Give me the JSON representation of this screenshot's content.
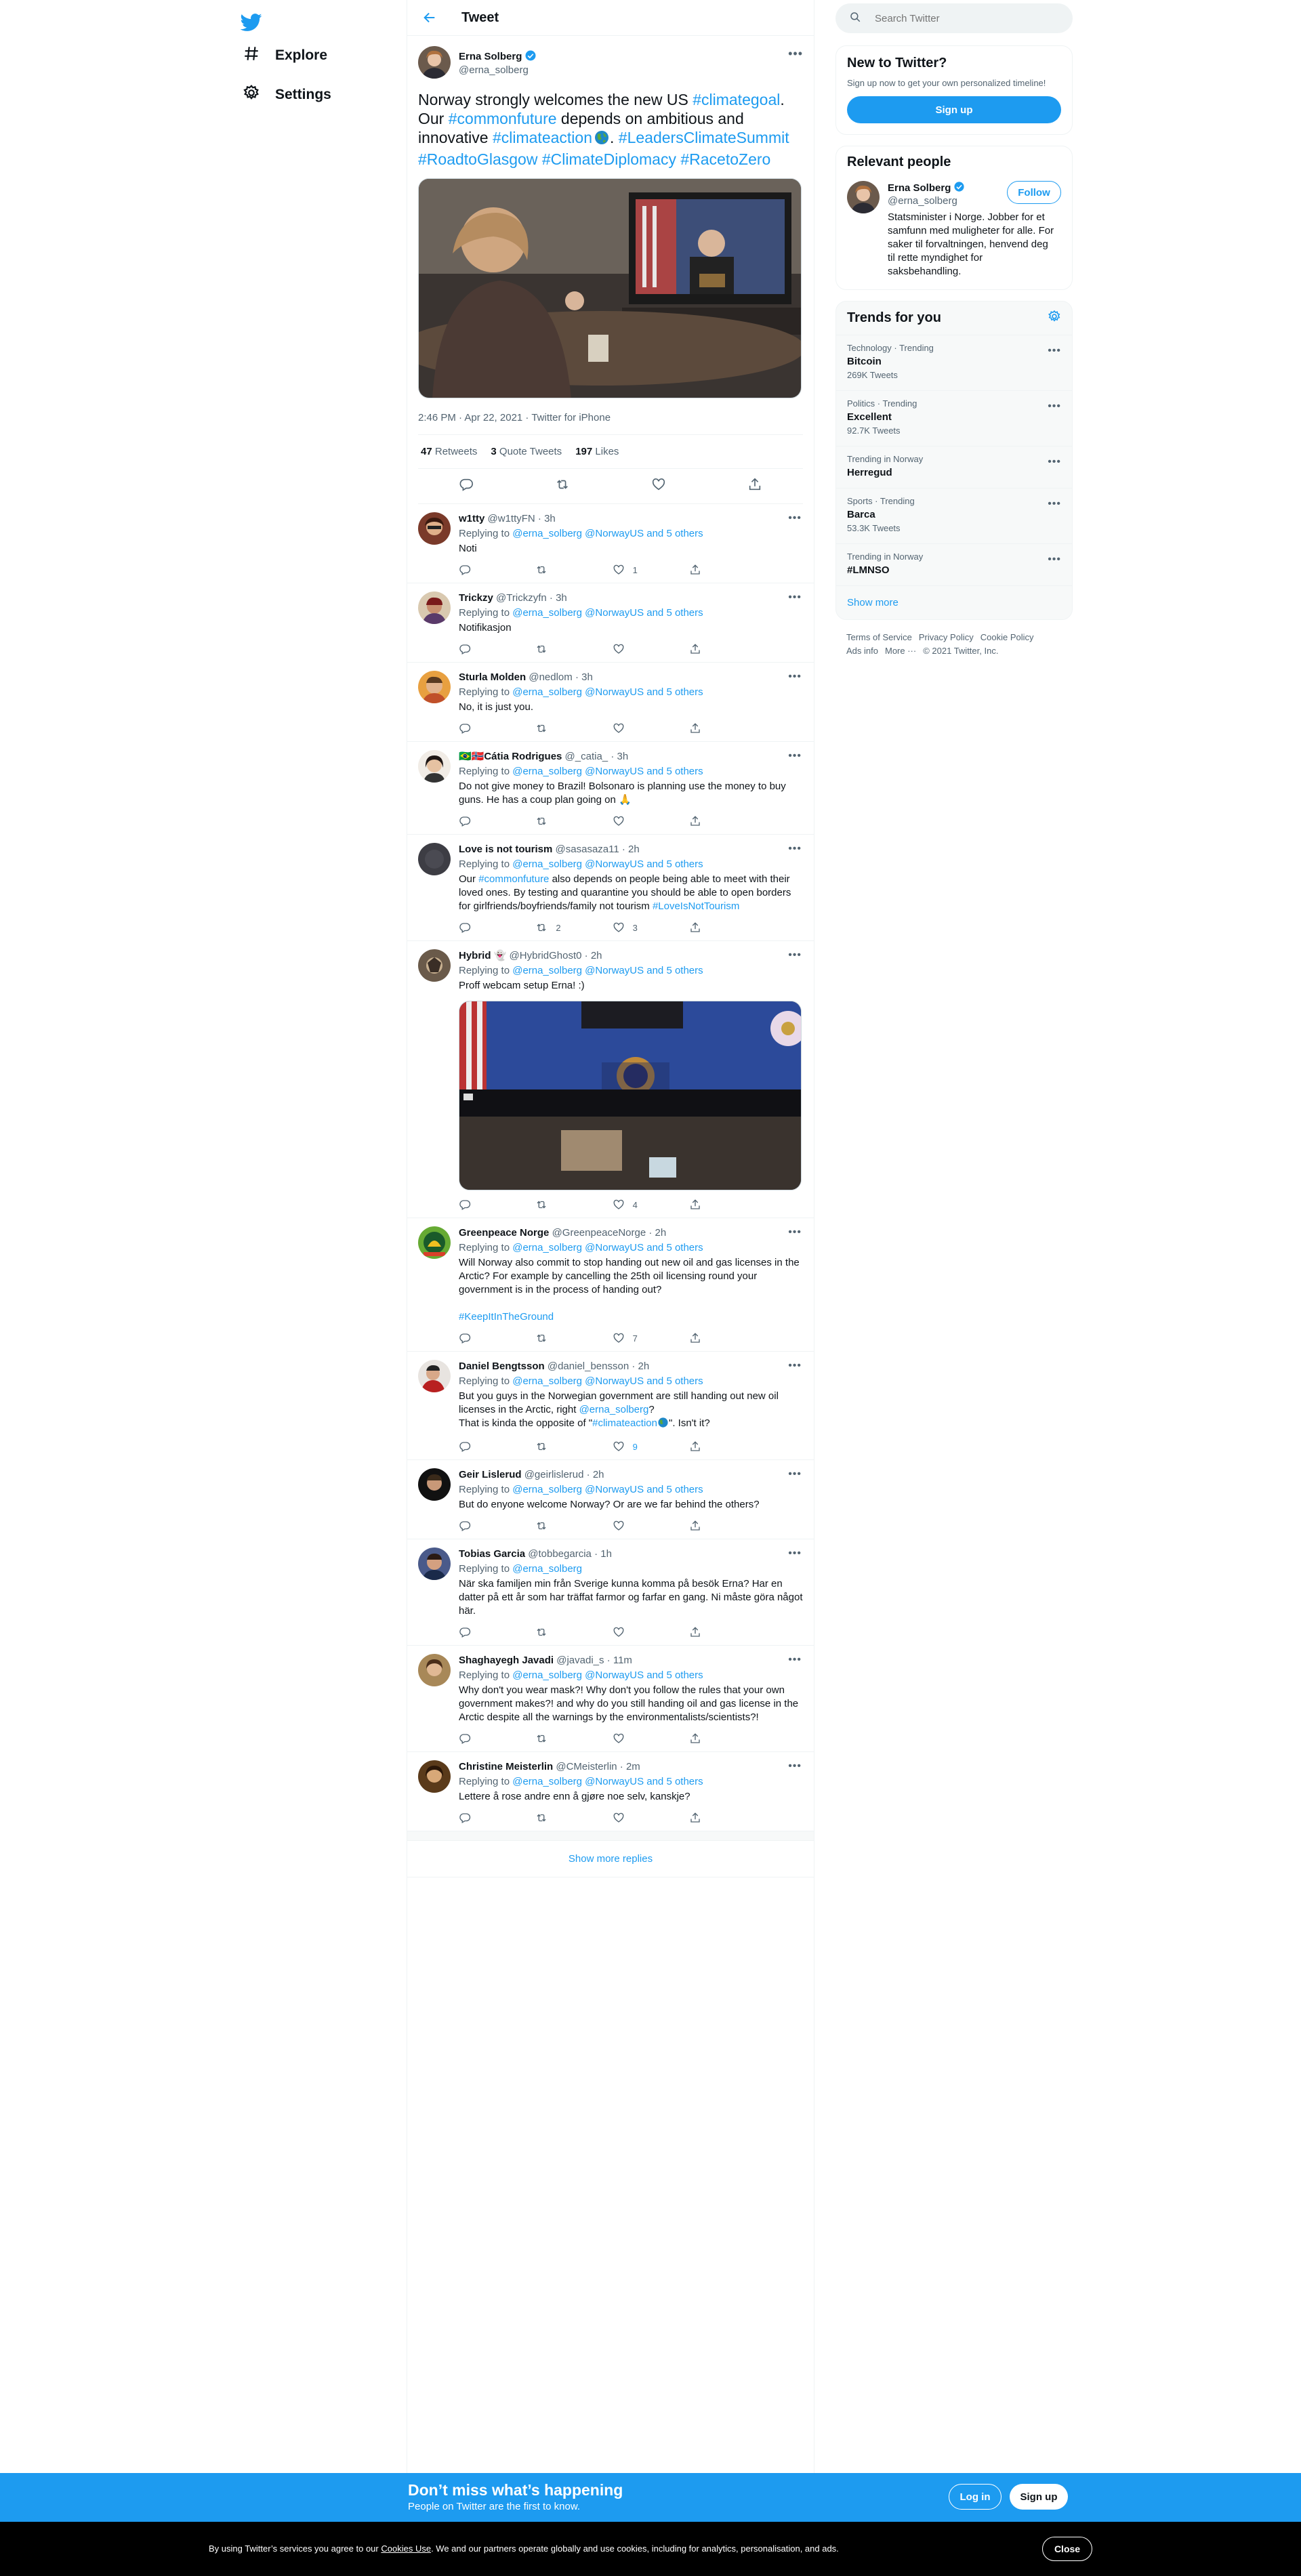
{
  "nav": {
    "items": [
      {
        "label": "Explore",
        "icon": "hashtag-icon"
      },
      {
        "label": "Settings",
        "icon": "gear-icon"
      }
    ]
  },
  "header": {
    "title": "Tweet"
  },
  "main_tweet": {
    "author": "Erna Solberg",
    "handle": "@erna_solberg",
    "text_parts": [
      "Norway strongly welcomes the new US ",
      "#climategoal",
      ". Our ",
      "#commonfuture",
      " depends on ambitious and innovative ",
      "#climateaction",
      ". ",
      "#LeadersClimateSummit",
      " ",
      "#RoadtoGlasgow",
      " ",
      "#ClimateDiplomacy",
      " ",
      "#RacetoZero"
    ],
    "meta": "2:46 PM · Apr 22, 2021 · Twitter for iPhone",
    "retweets": "47",
    "retweets_label": "Retweets",
    "quote_tweets": "3",
    "quote_tweets_label": "Quote Tweets",
    "likes": "197",
    "likes_label": "Likes"
  },
  "replies": [
    {
      "name": "w1tty",
      "handle": "@w1ttyFN",
      "time": "3h",
      "replying_prefix": "Replying to",
      "replying_to": "@erna_solberg @NorwayUS and 5 others",
      "text": "Noti",
      "retweets": "",
      "likes": "1"
    },
    {
      "name": "Trickzy",
      "handle": "@Trickzyfn",
      "time": "3h",
      "replying_prefix": "Replying to",
      "replying_to": "@erna_solberg @NorwayUS and 5 others",
      "text": "Notifikasjon",
      "retweets": "",
      "likes": ""
    },
    {
      "name": "Sturla Molden",
      "handle": "@nedlom",
      "time": "3h",
      "replying_prefix": "Replying to",
      "replying_to": "@erna_solberg @NorwayUS and 5 others",
      "text": "No, it is just you.",
      "retweets": "",
      "likes": ""
    },
    {
      "name": "🇧🇷🇳🇴Cátia Rodrigues",
      "handle": "@_catia_",
      "time": "3h",
      "replying_prefix": "Replying to",
      "replying_to": "@erna_solberg @NorwayUS and 5 others",
      "text": "Do not give money to Brazil! Bolsonaro is planning use the money to buy guns. He has a coup plan going on 🙏",
      "retweets": "",
      "likes": ""
    },
    {
      "name": "Love is not tourism",
      "handle": "@sasasaza11",
      "time": "2h",
      "replying_prefix": "Replying to",
      "replying_to": "@erna_solberg @NorwayUS and 5 others",
      "text_a": "Our ",
      "text_tag1": "#commonfuture",
      "text_b": " also depends on people being able to meet with their loved ones. By testing and quarantine you should be able to open borders for girlfriends/boyfriends/family not tourism ",
      "text_tag2": "#LoveIsNotTourism",
      "retweets": "2",
      "likes": "3"
    },
    {
      "name": "Hybrid",
      "handle": "@HybridGhost0",
      "time": "2h",
      "replying_prefix": "Replying to",
      "replying_to": "@erna_solberg @NorwayUS and 5 others",
      "text": "Proff webcam setup Erna! :)",
      "retweets": "",
      "likes": "4"
    },
    {
      "name": "Greenpeace Norge",
      "handle": "@GreenpeaceNorge",
      "time": "2h",
      "replying_prefix": "Replying to",
      "replying_to": "@erna_solberg @NorwayUS and 5 others",
      "text": "Will Norway also commit to stop handing out new oil and gas licenses in the Arctic? For example by cancelling the 25th oil licensing round your government is in the process of handing out?",
      "hashtag": "#KeepItInTheGround",
      "retweets": "",
      "likes": "7"
    },
    {
      "name": "Daniel Bengtsson",
      "handle": "@daniel_bensson",
      "time": "2h",
      "replying_prefix": "Replying to",
      "replying_to": "@erna_solberg @NorwayUS and 5 others",
      "text_a": "But you guys in the Norwegian government are still handing out new oil licenses in the Arctic, right ",
      "text_mention": "@erna_solberg",
      "text_b": "?\nThat is kinda the opposite of \"",
      "text_tag": "#climateaction",
      "text_c": "\". Isn't it?",
      "retweets": "",
      "likes": "9"
    },
    {
      "name": "Geir Lislerud",
      "handle": "@geirlislerud",
      "time": "2h",
      "replying_prefix": "Replying to",
      "replying_to": "@erna_solberg @NorwayUS and 5 others",
      "text": "But do enyone welcome Norway? Or are we far behind the others?",
      "retweets": "",
      "likes": ""
    },
    {
      "name": "Tobias Garcia",
      "handle": "@tobbegarcia",
      "time": "1h",
      "replying_prefix": "Replying to",
      "replying_to": "@erna_solberg",
      "text": "När ska familjen min från Sverige kunna komma på besök Erna? Har en datter på ett år som har träffat farmor og farfar en gang. Ni måste göra något här.",
      "retweets": "",
      "likes": ""
    },
    {
      "name": "Shaghayegh Javadi",
      "handle": "@javadi_s",
      "time": "11m",
      "replying_prefix": "Replying to",
      "replying_to": "@erna_solberg @NorwayUS and 5 others",
      "text": "Why don't you wear mask?! Why don't you follow the rules that your own government makes?! and why do you still handing oil and gas license in the Arctic despite all the warnings by the environmentalists/scientists?!",
      "retweets": "",
      "likes": ""
    },
    {
      "name": "Christine Meisterlin",
      "handle": "@CMeisterlin",
      "time": "2m",
      "replying_prefix": "Replying to",
      "replying_to": "@erna_solberg @NorwayUS and 5 others",
      "text": "Lettere å rose andre enn å gjøre noe selv, kanskje?",
      "retweets": "",
      "likes": ""
    }
  ],
  "show_more_replies": "Show more replies",
  "search": {
    "placeholder": "Search Twitter"
  },
  "new_to_twitter": {
    "title": "New to Twitter?",
    "subtitle": "Sign up now to get your own personalized timeline!",
    "button": "Sign up"
  },
  "relevant_people": {
    "title": "Relevant people",
    "name": "Erna Solberg",
    "handle": "@erna_solberg",
    "bio": "Statsminister i Norge. Jobber for et samfunn med muligheter for alle. For saker til forvaltningen, henvend deg til rette myndighet for saksbehandling.",
    "follow": "Follow"
  },
  "trends": {
    "title": "Trends for you",
    "items": [
      {
        "meta": "Technology · Trending",
        "name": "Bitcoin",
        "count": "269K Tweets"
      },
      {
        "meta": "Politics · Trending",
        "name": "Excellent",
        "count": "92.7K Tweets"
      },
      {
        "meta": "Trending in Norway",
        "name": "Herregud",
        "count": ""
      },
      {
        "meta": "Sports · Trending",
        "name": "Barca",
        "count": "53.3K Tweets"
      },
      {
        "meta": "Trending in Norway",
        "name": "#LMNSO",
        "count": ""
      }
    ],
    "show_more": "Show more"
  },
  "footer": {
    "links": [
      "Terms of Service",
      "Privacy Policy",
      "Cookie Policy",
      "Ads info",
      "More ···"
    ],
    "copyright": "© 2021 Twitter, Inc."
  },
  "signup_bar": {
    "title": "Don’t miss what’s happening",
    "subtitle": "People on Twitter are the first to know.",
    "login": "Log in",
    "signup": "Sign up"
  },
  "cookie_bar": {
    "text_a": "By using Twitter’s services you agree to our ",
    "link": "Cookies Use",
    "text_b": ". We and our partners operate globally and use cookies, including for analytics, personalisation, and ads.",
    "close": "Close"
  },
  "colors": {
    "accent": "#1d9bf0",
    "bottom_bar": "#1d9bf0",
    "cookie_bar": "#000000"
  }
}
